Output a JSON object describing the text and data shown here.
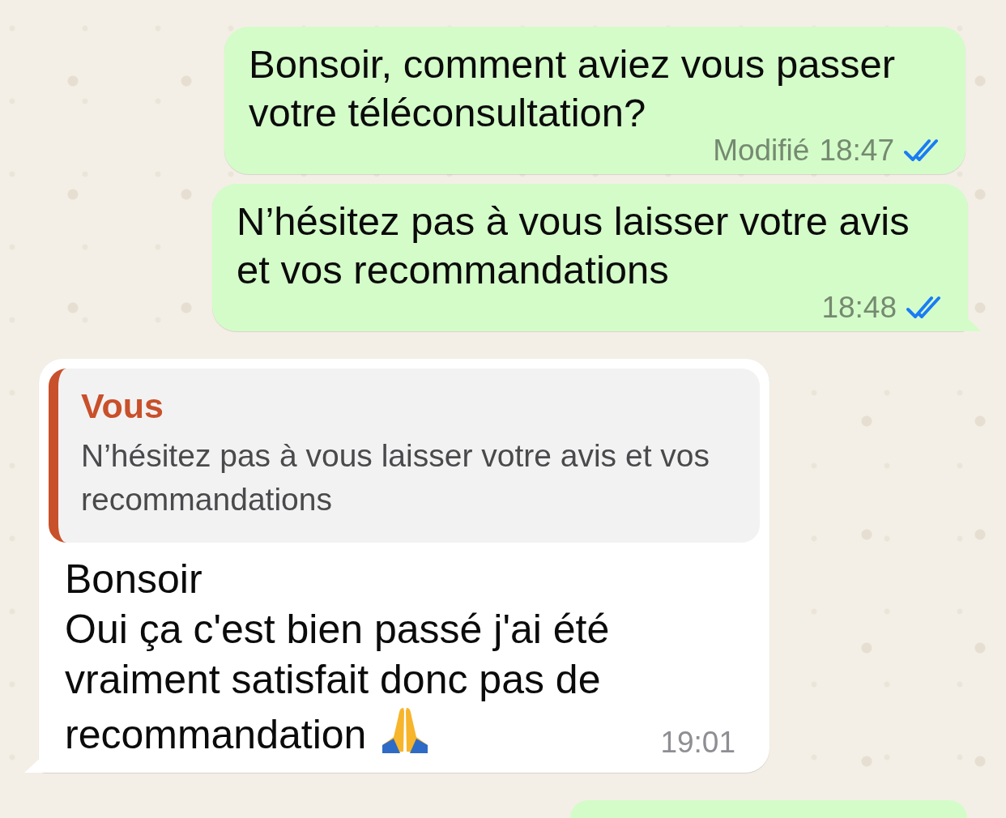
{
  "messages": [
    {
      "kind": "outgoing",
      "text": "Bonsoir, comment aviez vous passer votre téléconsultation?",
      "edited": "Modifié",
      "time": "18:47",
      "read": true,
      "tail": false
    },
    {
      "kind": "outgoing",
      "text": "N’hésitez pas à vous laisser votre avis et vos recommandations",
      "time": "18:48",
      "read": true,
      "tail": true
    },
    {
      "kind": "incoming",
      "quote": {
        "author": "Vous",
        "text": "N’hésitez pas à vous laisser votre avis et vos recommandations"
      },
      "lines": [
        "Bonsoir",
        "Oui ça c'est bien passé j'ai été vraiment satisfait donc pas de recommandation"
      ],
      "time": "19:01",
      "tail": true
    },
    {
      "kind": "outgoing_partial"
    }
  ]
}
